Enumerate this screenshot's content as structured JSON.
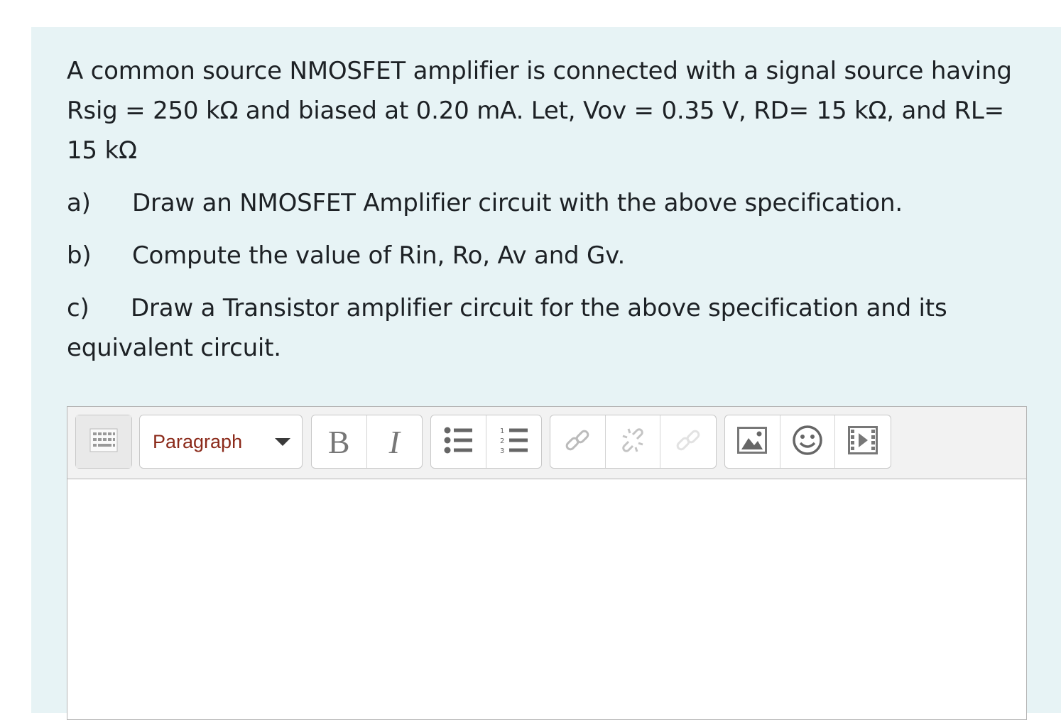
{
  "question": {
    "intro": "A common source NMOSFET amplifier is connected with a signal source having Rsig = 250 kΩ and biased at 0.20 mA. Let, Vov = 0.35 V, RD= 15 kΩ, and RL= 15 kΩ",
    "items": [
      {
        "marker": "a)",
        "text": "Draw an NMOSFET Amplifier circuit with the above specification."
      },
      {
        "marker": "b)",
        "text": "Compute the value of Rin, Ro, Av and Gv."
      },
      {
        "marker": "c)",
        "text": "Draw a Transistor amplifier circuit for the above specification and its equivalent circuit."
      }
    ]
  },
  "editor": {
    "toolbar": {
      "toggle_icon": "toolbar-toggle-icon",
      "paragraph_select": {
        "selected": "Paragraph"
      },
      "bold_label": "B",
      "italic_label": "I",
      "icons": [
        "unordered-list-icon",
        "ordered-list-icon",
        "link-icon",
        "unlink-icon",
        "anchor-icon",
        "image-icon",
        "emoticon-icon",
        "media-icon"
      ]
    },
    "content": ""
  },
  "colors": {
    "card_bg": "#e7f3f5",
    "text": "#1d2125",
    "select_text": "#8b2a1a",
    "toolbar_bg": "#f2f2f2"
  }
}
